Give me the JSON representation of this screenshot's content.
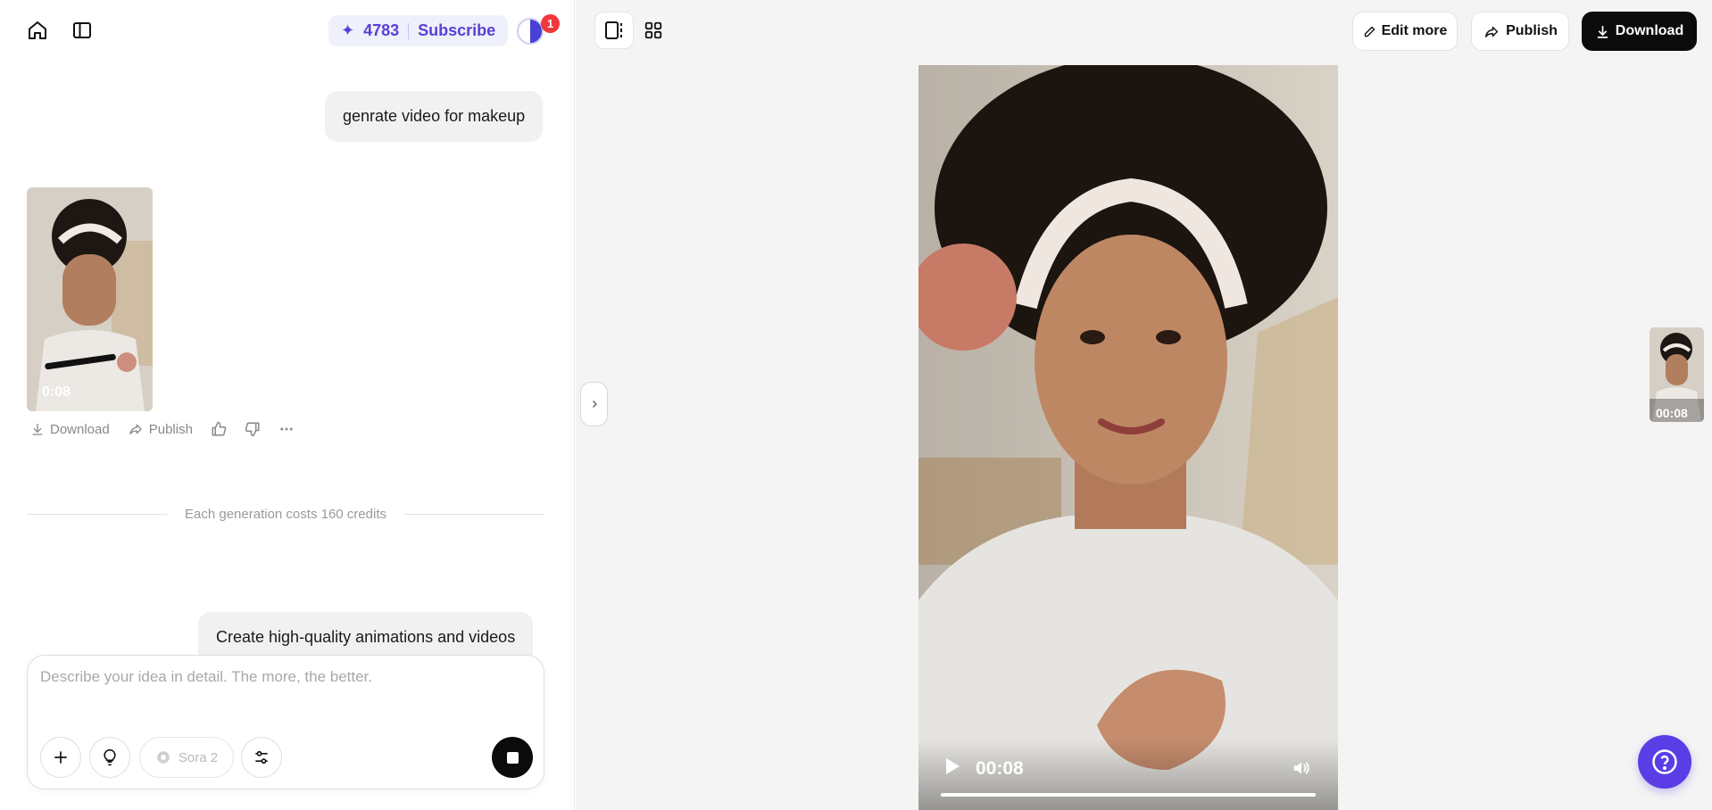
{
  "header": {
    "credits": "4783",
    "subscribe_label": "Subscribe",
    "notification_count": "1"
  },
  "chat": {
    "messages": [
      {
        "role": "user",
        "text": "genrate video for makeup"
      },
      {
        "role": "user",
        "text": "Create high-quality animations and videos"
      }
    ],
    "result": {
      "duration": "0:08",
      "actions": {
        "download": "Download",
        "publish": "Publish"
      }
    },
    "cost_note": "Each generation costs 160 credits"
  },
  "composer": {
    "placeholder": "Describe your idea in detail. The more, the better.",
    "model": "Sora 2"
  },
  "toolbar": {
    "edit_more": "Edit more",
    "publish": "Publish",
    "download": "Download"
  },
  "player": {
    "time": "00:08",
    "progress": 1.0
  },
  "side_thumbnail": {
    "duration": "00:08"
  },
  "colors": {
    "accent": "#5b3de6",
    "credits_text": "#5a3fd6",
    "notification": "#f0373c"
  }
}
